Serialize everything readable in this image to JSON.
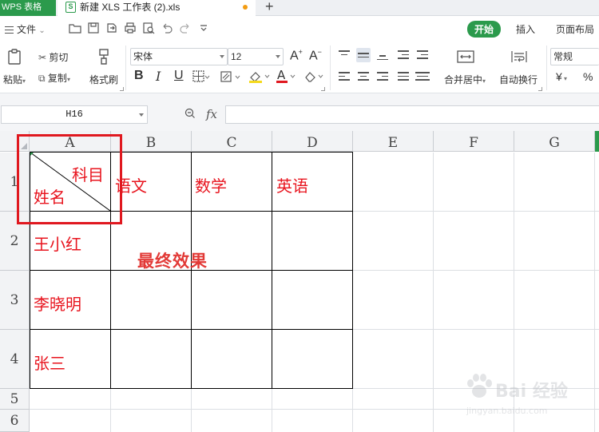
{
  "tabs": {
    "app_label": "WPS 表格",
    "file_label": "新建 XLS 工作表 (2).xls",
    "add_symbol": "+"
  },
  "menu": {
    "file_label": "文件",
    "ribbon_tabs": [
      "开始",
      "插入",
      "页面布局"
    ],
    "active_tab": "开始"
  },
  "ribbon": {
    "paste_label": "粘贴",
    "cut_label": "剪切",
    "copy_label": "复制",
    "format_painter_label": "格式刷",
    "font_name": "宋体",
    "font_size": "12",
    "merge_center_label": "合并居中",
    "wrap_text_label": "自动换行",
    "number_format": "常规",
    "currency_symbol": "¥",
    "percent_symbol": "%"
  },
  "formula_bar": {
    "name_box": "H16",
    "fx_label": "fx",
    "formula": ""
  },
  "grid": {
    "columns": [
      "A",
      "B",
      "C",
      "D",
      "E",
      "F",
      "G"
    ],
    "rows": [
      "1",
      "2",
      "3",
      "4",
      "5",
      "6"
    ],
    "header_a1_top_right": "科目",
    "header_a1_bottom_left": "姓名",
    "subjects": [
      "语文",
      "数学",
      "英语"
    ],
    "names": [
      "王小红",
      "李晓明",
      "张三"
    ],
    "annotation": "最终效果"
  },
  "colors": {
    "accent_green": "#2b9a4c",
    "text_red": "#e8141e",
    "highlight_red": "#e0181f"
  },
  "watermark": {
    "logo": "Bai 经验",
    "url": "jingyan.baidu.com"
  }
}
